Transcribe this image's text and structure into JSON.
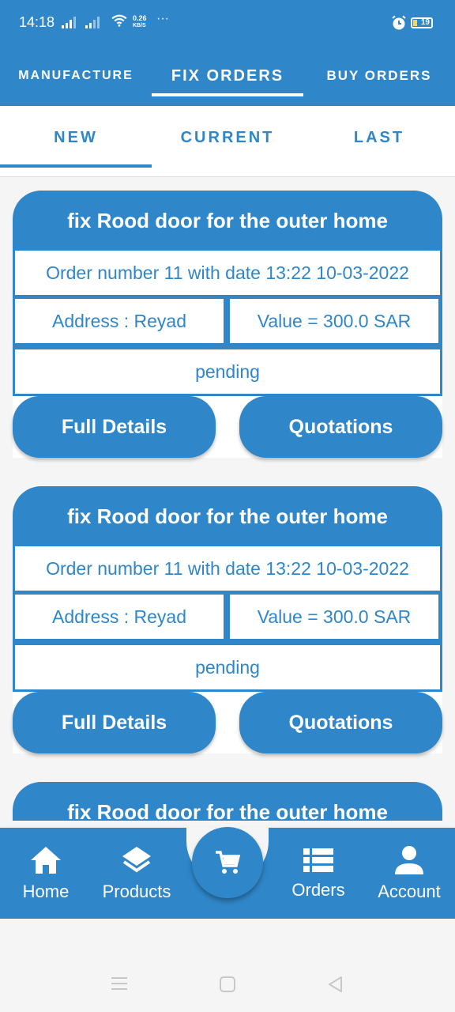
{
  "status": {
    "time": "14:18",
    "net_speed": "0.26",
    "net_unit": "KB/S",
    "more": "···",
    "battery": "19"
  },
  "top_tabs": [
    {
      "label": "MANUFACTURE"
    },
    {
      "label": "FIX ORDERS"
    },
    {
      "label": "BUY ORDERS"
    }
  ],
  "sub_tabs": [
    {
      "label": "NEW"
    },
    {
      "label": "CURRENT"
    },
    {
      "label": "LAST"
    }
  ],
  "orders": [
    {
      "title": "fix Rood door for the outer home",
      "info": "Order number 11 with date 13:22 10-03-2022",
      "address": "Address : Reyad",
      "value": "Value = 300.0 SAR",
      "status": "pending",
      "details_label": "Full Details",
      "quotes_label": "Quotations"
    },
    {
      "title": "fix Rood door for the outer home",
      "info": "Order number 11 with date 13:22 10-03-2022",
      "address": "Address : Reyad",
      "value": "Value = 300.0 SAR",
      "status": "pending",
      "details_label": "Full Details",
      "quotes_label": "Quotations"
    },
    {
      "title": "fix Rood door for the outer home"
    }
  ],
  "bottom_nav": {
    "home": "Home",
    "products": "Products",
    "orders": "Orders",
    "account": "Account"
  },
  "colors": {
    "primary": "#2f86c8",
    "background": "#f5f5f5"
  }
}
